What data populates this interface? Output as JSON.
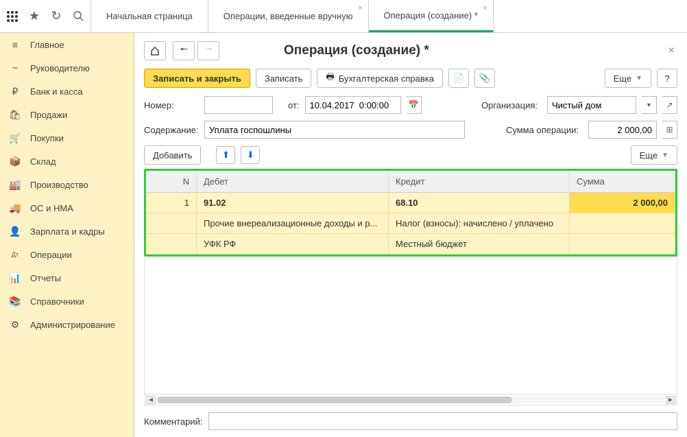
{
  "tabs": [
    {
      "label": "Начальная страница",
      "closable": false,
      "active": false
    },
    {
      "label": "Операции, введенные вручную",
      "closable": true,
      "active": false
    },
    {
      "label": "Операция (создание) *",
      "closable": true,
      "active": true
    }
  ],
  "sidebar": [
    {
      "icon": "≡",
      "label": "Главное"
    },
    {
      "icon": "~",
      "label": "Руководителю"
    },
    {
      "icon": "₽",
      "label": "Банк и касса"
    },
    {
      "icon": "🛍",
      "label": "Продажи"
    },
    {
      "icon": "🛒",
      "label": "Покупки"
    },
    {
      "icon": "📦",
      "label": "Склад"
    },
    {
      "icon": "🏭",
      "label": "Производство"
    },
    {
      "icon": "🚚",
      "label": "ОС и НМА"
    },
    {
      "icon": "👤",
      "label": "Зарплата и кадры"
    },
    {
      "icon": "Дт",
      "label": "Операции"
    },
    {
      "icon": "📊",
      "label": "Отчеты"
    },
    {
      "icon": "📚",
      "label": "Справочники"
    },
    {
      "icon": "⚙",
      "label": "Администрирование"
    }
  ],
  "doc": {
    "title": "Операция (создание) *",
    "toolbar": {
      "save_close": "Записать и закрыть",
      "save": "Записать",
      "acct_ref": "Бухгалтерская справка",
      "more": "Еще"
    },
    "form": {
      "number_label": "Номер:",
      "number_value": "",
      "from_label": "от:",
      "date_value": "10.04.2017  0:00:00",
      "org_label": "Организация:",
      "org_value": "Чистый дом",
      "content_label": "Содержание:",
      "content_value": "Уплата госпошлины",
      "sum_label": "Сумма операции:",
      "sum_value": "2 000,00",
      "comment_label": "Комментарий:",
      "comment_value": ""
    },
    "table_toolbar": {
      "add": "Добавить",
      "more": "Еще"
    },
    "grid": {
      "headers": {
        "n": "N",
        "debit": "Дебет",
        "credit": "Кредит",
        "sum": "Сумма"
      },
      "rows": [
        {
          "n": "1",
          "debit": "91.02",
          "credit": "68.10",
          "sum": "2 000,00"
        },
        {
          "n": "",
          "debit": "Прочие внереализационные доходы и р...",
          "credit": "Налог (взносы): начислено / уплачено",
          "sum": ""
        },
        {
          "n": "",
          "debit": "УФК РФ",
          "credit": "Местный бюджет",
          "sum": ""
        }
      ]
    }
  }
}
